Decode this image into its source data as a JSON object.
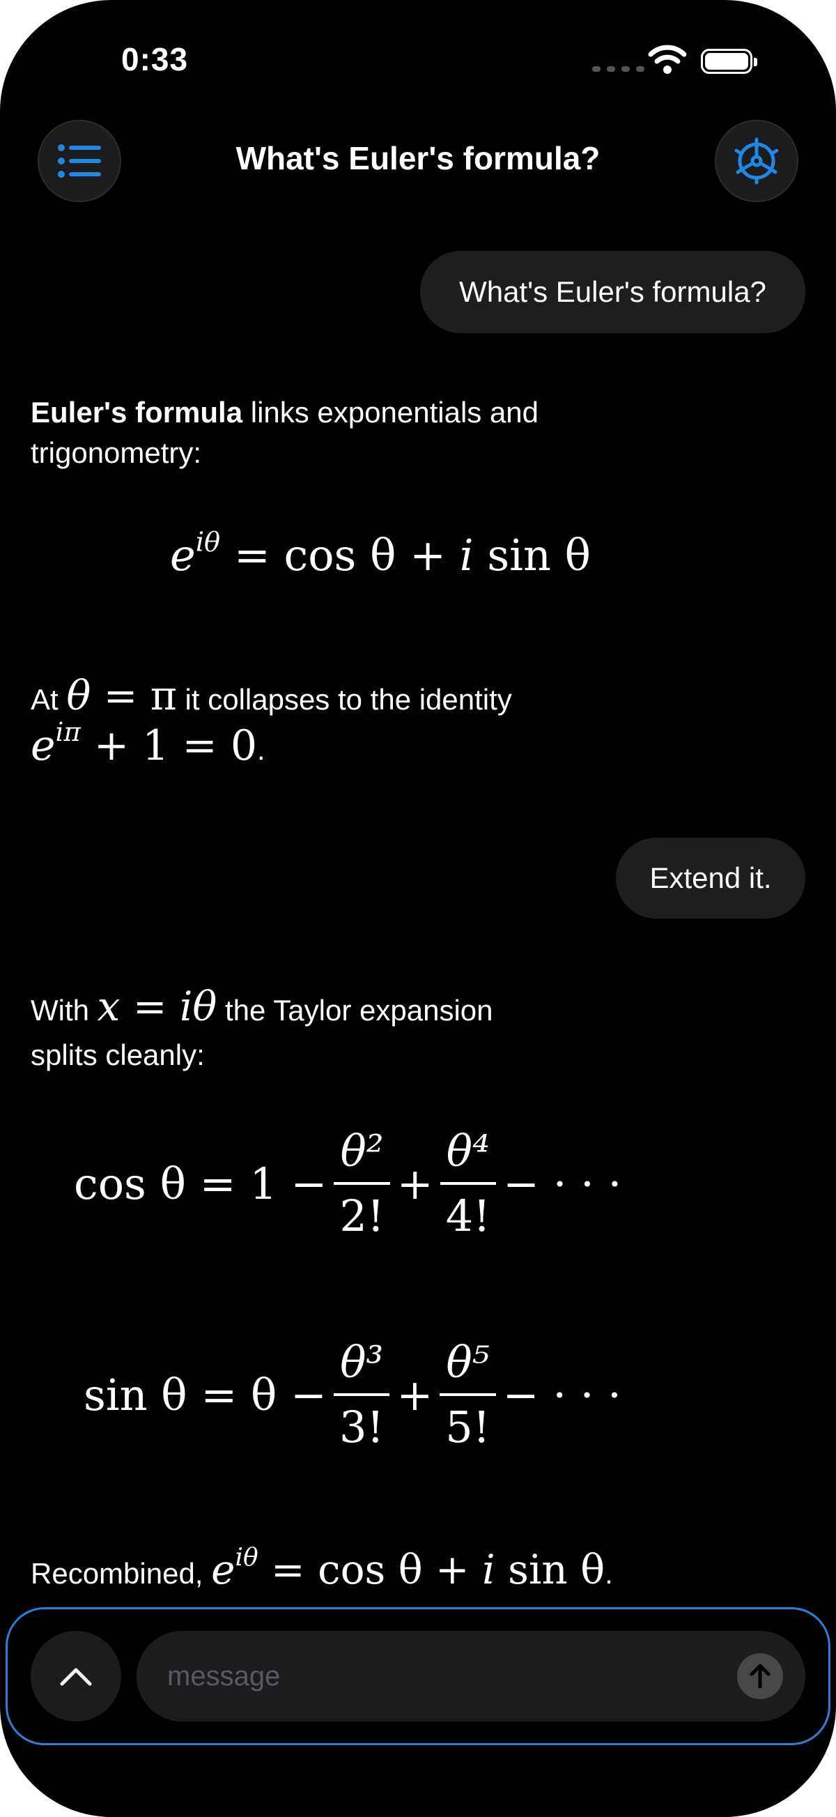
{
  "status_bar": {
    "time": "0:33"
  },
  "header": {
    "title": "What's Euler's formula?"
  },
  "messages": {
    "user1": "What's Euler's formula?",
    "a1": {
      "bold": "Euler's formula",
      "rest": " links exponentials and",
      "line2": "trigonometry:",
      "eq_base": "e",
      "eq_sup": "iθ",
      "eq_rest": " = cos θ + ",
      "eq_i": "i",
      "eq_end": " sin θ",
      "at": "At ",
      "theta": "θ",
      "eq_pi": " = π",
      "collapse": " it collapses to the identity",
      "id_base": "e",
      "id_sup": "iπ",
      "id_rest": " + 1  = 0",
      "period": "."
    },
    "user2": "Extend it.",
    "a2": {
      "with": "With ",
      "x": "x",
      "eq_itheta": " = iθ",
      "taylor": " the Taylor expansion",
      "line2": "splits cleanly:",
      "cos_lhs": "cos θ = 1 −",
      "cos_n1": "θ²",
      "cos_d1": "2!",
      "plus": "+",
      "cos_n2": "θ⁴",
      "cos_d2": "4!",
      "cos_tail": "− · · ·",
      "sin_lhs": "sin θ = θ −",
      "sin_n1": "θ³",
      "sin_d1": "3!",
      "sin_n2": "θ⁵",
      "sin_d2": "5!",
      "sin_tail": "− · · ·",
      "recombined": "Recombined, ",
      "rc_base": "e",
      "rc_sup": "iθ",
      "rc_rest": " = cos θ + ",
      "rc_i": "i",
      "rc_end": " sin θ",
      "period": "."
    }
  },
  "composer": {
    "placeholder": "message"
  },
  "colors": {
    "accent": "#1e88e5",
    "bubble": "#1e1e20",
    "background": "#000000"
  },
  "icons": {
    "menu": "list-icon",
    "settings": "helm-gear-icon",
    "expand": "chevron-up-icon",
    "send": "arrow-up-icon"
  }
}
